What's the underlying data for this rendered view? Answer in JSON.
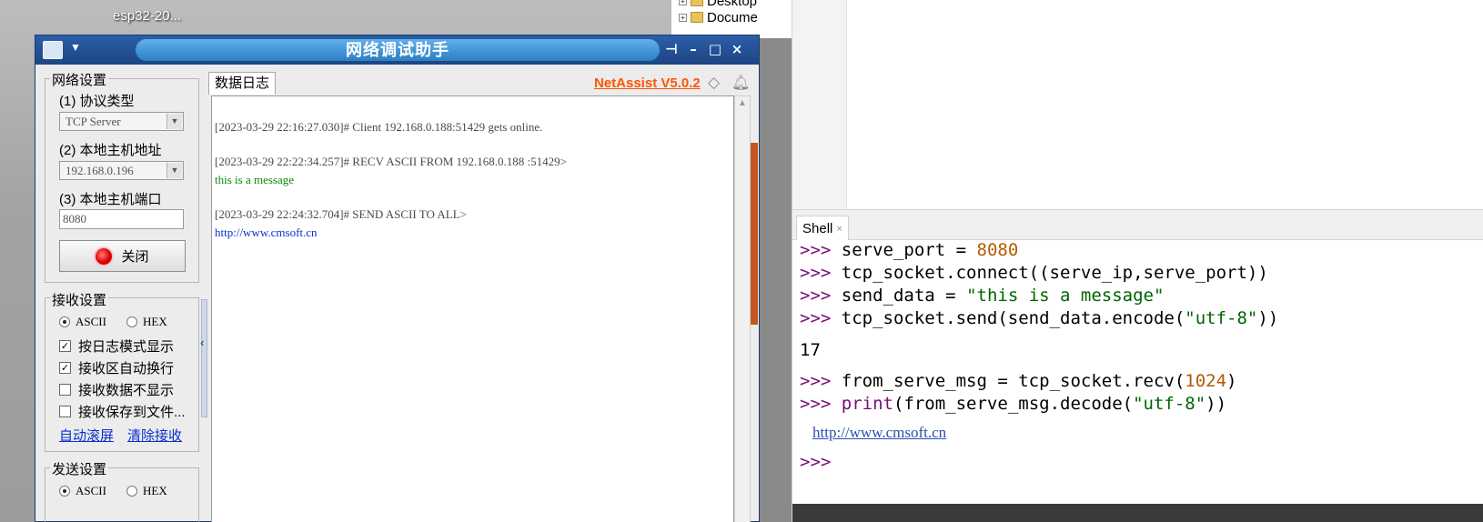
{
  "desktop": {
    "shortcut_label": "esp32-20..."
  },
  "explorer": {
    "items": [
      {
        "label": "Desktop"
      },
      {
        "label": "Docume"
      }
    ]
  },
  "ide": {
    "shell_tab": "Shell",
    "shell_tab_close": "×",
    "shell_lines": [
      {
        "prompt": ">>>",
        "code_a": "serve_port = ",
        "num": "8080"
      },
      {
        "prompt": ">>>",
        "code": "tcp_socket.connect((serve_ip,serve_port))"
      },
      {
        "prompt": ">>>",
        "code_a": "send_data = ",
        "str": "\"this is a message\""
      },
      {
        "prompt": ">>>",
        "code_a": "tcp_socket.send(send_data.encode(",
        "str": "\"utf-8\"",
        "code_b": "))"
      },
      {
        "output": "17"
      },
      {
        "prompt": ">>>",
        "code_a": "from_serve_msg = tcp_socket.recv(",
        "num": "1024",
        "code_b": ")"
      },
      {
        "prompt": ">>>",
        "kw": "print",
        "code_a": "(from_serve_msg.decode(",
        "str": "\"utf-8\"",
        "code_b": "))"
      },
      {
        "link": "http://www.cmsoft.cn"
      },
      {
        "prompt": ">>>"
      }
    ]
  },
  "netassist": {
    "title": "网络调试助手",
    "window_buttons": {
      "pin": "⊣",
      "minimize": "–",
      "maximize": "□",
      "close": "×"
    },
    "network": {
      "legend": "网络设置",
      "protocol_label": "(1) 协议类型",
      "protocol_value": "TCP Server",
      "host_label": "(2) 本地主机地址",
      "host_value": "192.168.0.196",
      "port_label": "(3) 本地主机端口",
      "port_value": "8080",
      "close_button": "关闭"
    },
    "receive": {
      "legend": "接收设置",
      "ascii": "ASCII",
      "hex": "HEX",
      "options": [
        {
          "label": "按日志模式显示",
          "checked": true
        },
        {
          "label": "接收区自动换行",
          "checked": true
        },
        {
          "label": "接收数据不显示",
          "checked": false
        },
        {
          "label": "接收保存到文件...",
          "checked": false
        }
      ],
      "auto_scroll": "自动滚屏",
      "clear": "清除接收"
    },
    "send": {
      "legend": "发送设置",
      "ascii": "ASCII",
      "hex": "HEX"
    },
    "log": {
      "tab": "数据日志",
      "brand": "NetAssist V5.0.2",
      "lines": [
        {
          "text": "[2023-03-29 22:16:27.030]# Client 192.168.0.188:51429 gets online.",
          "kind": "meta"
        },
        {
          "text": "[2023-03-29 22:22:34.257]# RECV ASCII FROM 192.168.0.188 :51429>",
          "kind": "meta"
        },
        {
          "text": "this is a message",
          "kind": "recv"
        },
        {
          "text": "[2023-03-29 22:24:32.704]# SEND ASCII TO ALL>",
          "kind": "meta"
        },
        {
          "text": "http://www.cmsoft.cn",
          "kind": "send"
        }
      ]
    }
  },
  "colors": {
    "title_bar": "#1c4583",
    "brand": "#ff5500",
    "recv_text": "#0a8a0a",
    "send_text": "#0a2fd0",
    "prompt": "#7a0a7a"
  }
}
